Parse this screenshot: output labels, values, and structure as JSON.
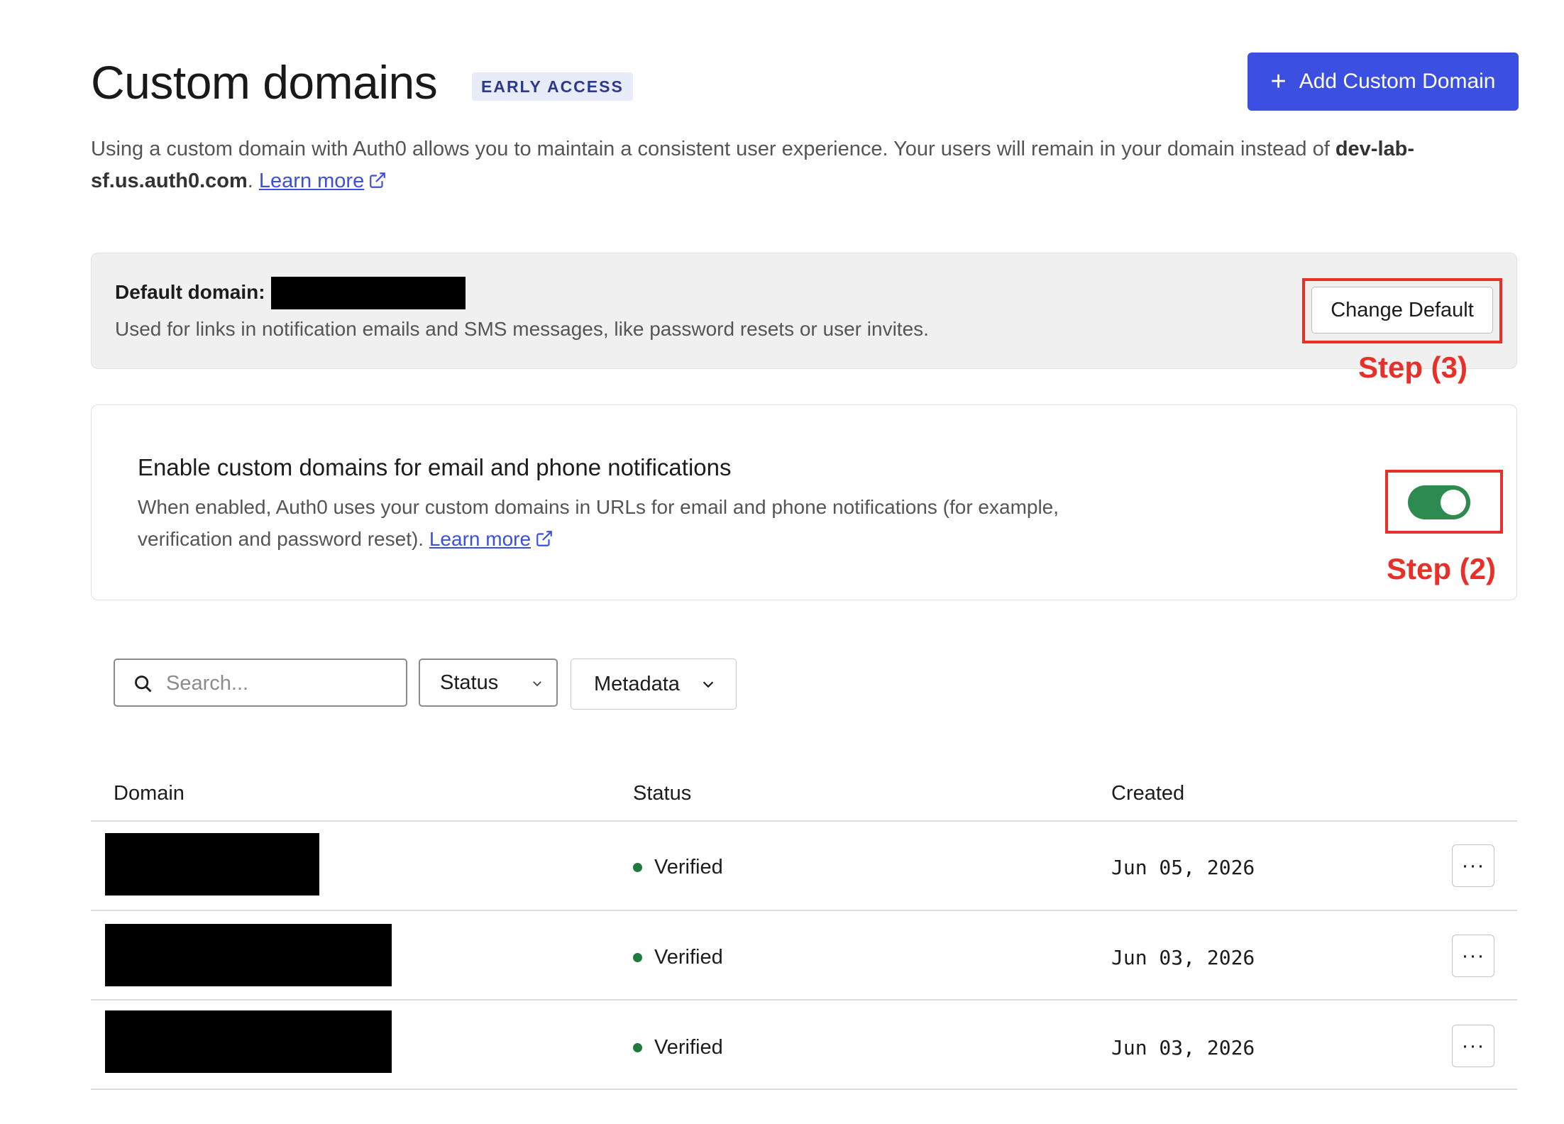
{
  "header": {
    "title": "Custom domains",
    "badge": "EARLY ACCESS",
    "add_button_label": "Add Custom Domain",
    "add_button_icon": "plus-icon"
  },
  "intro": {
    "text_before": "Using a custom domain with Auth0 allows you to maintain a consistent user experience. Your users will remain in your domain instead of ",
    "tenant_domain": "dev-lab-sf.us.auth0.com",
    "text_after": ". ",
    "learn_more": "Learn more"
  },
  "default_domain": {
    "label": "Default domain:",
    "description": "Used for links in notification emails and SMS messages, like password resets or user invites.",
    "change_button": "Change Default"
  },
  "notifications": {
    "title": "Enable custom domains for email and phone notifications",
    "description": "When enabled, Auth0 uses your custom domains in URLs for email and phone notifications (for example, verification and password reset). ",
    "learn_more": "Learn more",
    "toggle_enabled": true,
    "toggle_color": "#2e8b4f"
  },
  "annotations": {
    "step2": "Step (2)",
    "step3": "Step (3)",
    "color": "#e8302a"
  },
  "filters": {
    "search_placeholder": "Search...",
    "status_label": "Status",
    "metadata_label": "Metadata"
  },
  "table": {
    "headers": [
      "Domain",
      "Status",
      "Created"
    ],
    "rows": [
      {
        "status": "Verified",
        "created": "Jun 05, 2026"
      },
      {
        "status": "Verified",
        "created": "Jun 03, 2026"
      },
      {
        "status": "Verified",
        "created": "Jun 03, 2026"
      }
    ],
    "row_action": "···"
  },
  "colors": {
    "accent": "#3b4fe0",
    "verified_dot": "#1f7a3d"
  }
}
